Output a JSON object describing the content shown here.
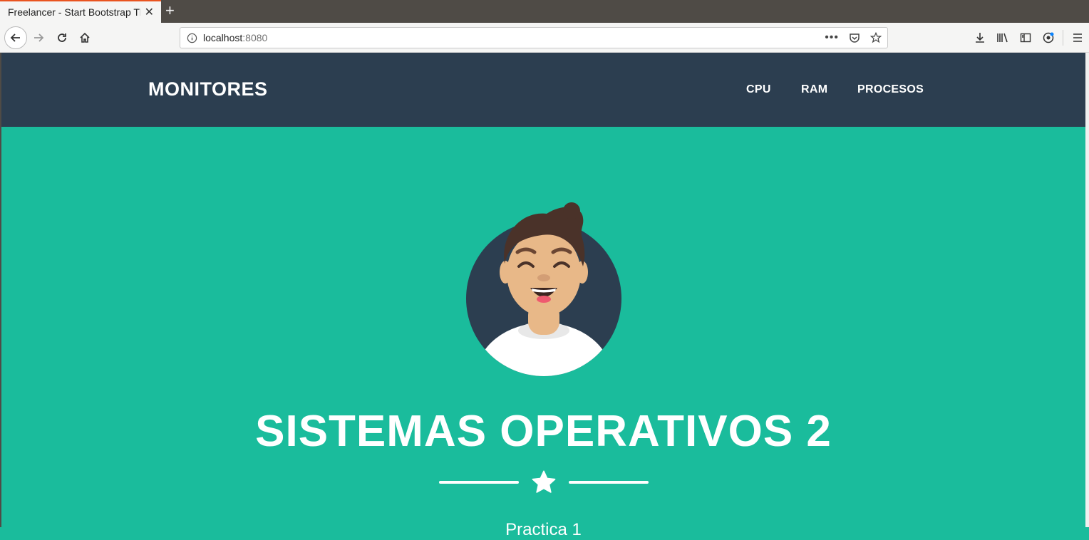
{
  "browser": {
    "tab_title": "Freelancer - Start Bootstrap Theme",
    "new_tab_symbol": "+",
    "url_host": "localhost",
    "url_port": ":8080",
    "icons": [
      "back-arrow-icon",
      "forward-arrow-icon",
      "reload-icon",
      "home-icon",
      "info-icon",
      "more-dots-icon",
      "pocket-icon",
      "bookmark-star-icon",
      "download-icon",
      "library-icon",
      "sidebar-icon",
      "account-icon",
      "menu-icon"
    ]
  },
  "site": {
    "brand": "MONITORES",
    "menu": [
      "CPU",
      "RAM",
      "PROCESOS"
    ],
    "colors": {
      "nav_bg": "#2c3e50",
      "hero_bg": "#1abc9c",
      "text": "#ffffff"
    }
  },
  "hero": {
    "title": "SISTEMAS OPERATIVOS 2",
    "subtitle": "Practica 1",
    "divider_icon": "star-icon"
  }
}
